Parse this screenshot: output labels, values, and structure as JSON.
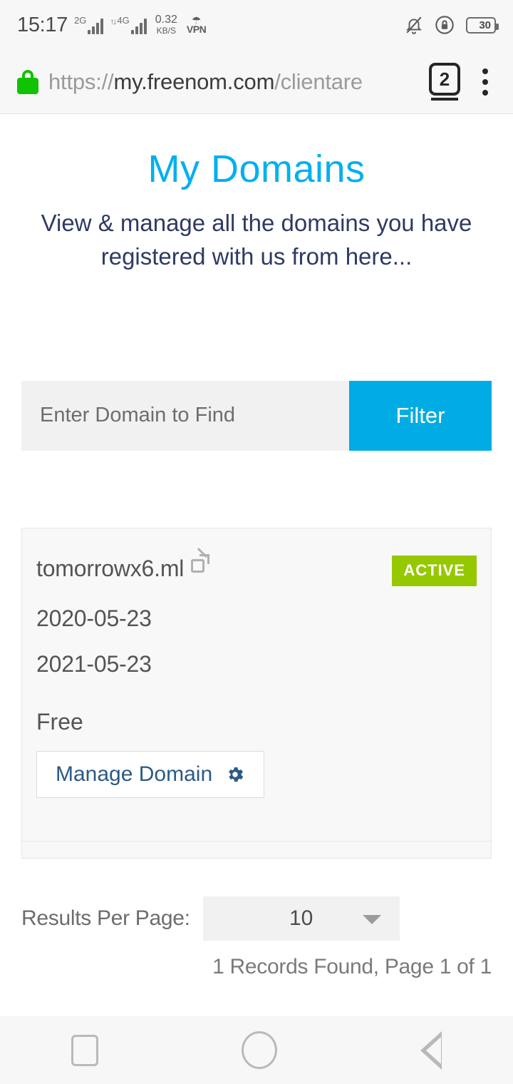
{
  "statusbar": {
    "time": "15:17",
    "network_1": "2G",
    "network_2": "4G",
    "data_speed_value": "0.32",
    "data_speed_unit": "KB/S",
    "vpn_label": "VPN",
    "battery_percent": "30",
    "icons": [
      "mute-bell-icon",
      "rotation-lock-icon",
      "battery-icon"
    ]
  },
  "browser": {
    "url_scheme": "https://",
    "url_host": "my.freenom.com",
    "url_path": "/clientare",
    "tab_count": "2",
    "menu_icon": "kebab-menu-icon",
    "lock_icon": "secure-lock-icon"
  },
  "page": {
    "title": "My Domains",
    "subtitle": "View & manage all the domains you have registered with us from here...",
    "search": {
      "placeholder": "Enter Domain to Find",
      "value": "",
      "filter_label": "Filter"
    },
    "domains": [
      {
        "name": "tomorrowx6.ml",
        "external_link_icon": "external-link-icon",
        "status": "ACTIVE",
        "registration_date": "2020-05-23",
        "expiry_date": "2021-05-23",
        "type": "Free",
        "manage_label": "Manage Domain",
        "manage_icon": "gear-icon"
      }
    ],
    "pagination": {
      "results_per_page_label": "Results Per Page:",
      "results_per_page_value": "10",
      "records_text": "1 Records Found, Page 1 of 1"
    }
  },
  "navbar": {
    "recents": "recents-square-icon",
    "home": "home-circle-icon",
    "back": "back-triangle-icon"
  },
  "colors": {
    "accent_blue": "#00b0ef",
    "filter_blue": "#00ace3",
    "navy": "#2e3a63",
    "active_green": "#96c800",
    "lock_green": "#10c200",
    "link_navy": "#2b5a85"
  }
}
